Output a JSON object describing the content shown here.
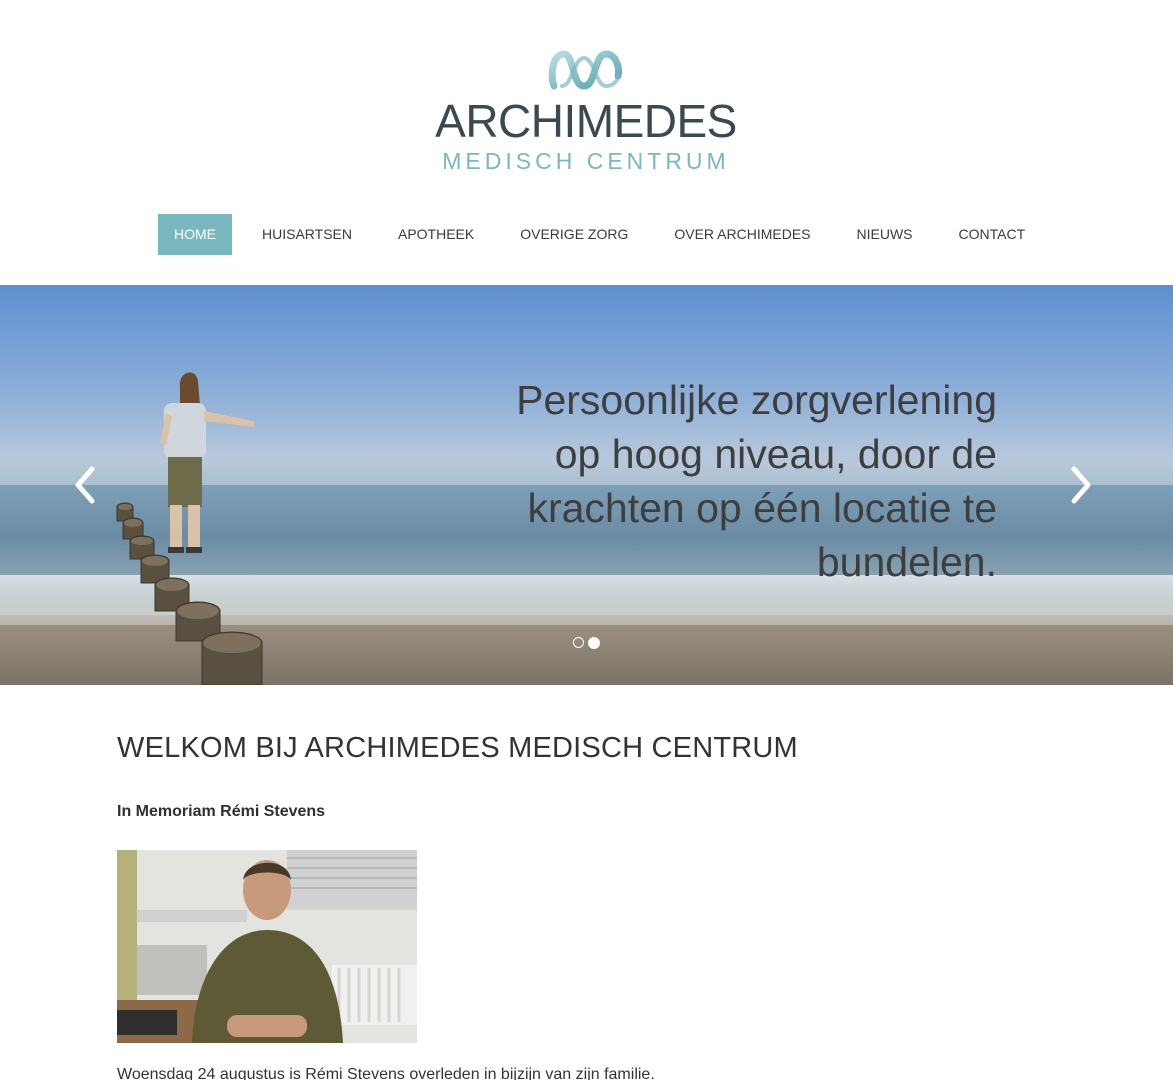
{
  "logo": {
    "name": "ARCHIMEDES",
    "subtitle": "MEDISCH CENTRUM",
    "mark_icon": "archimedes-wave-logo-icon"
  },
  "nav": {
    "items": [
      {
        "label": "HOME",
        "active": true
      },
      {
        "label": "HUISARTSEN",
        "active": false
      },
      {
        "label": "APOTHEEK",
        "active": false
      },
      {
        "label": "OVERIGE ZORG",
        "active": false
      },
      {
        "label": "OVER ARCHIMEDES",
        "active": false
      },
      {
        "label": "NIEUWS",
        "active": false
      },
      {
        "label": "CONTACT",
        "active": false
      }
    ]
  },
  "hero": {
    "caption": "Persoonlijke zorgverlening op hoog niveau, door de krachten op één locatie te bundelen.",
    "prev_icon": "chevron-left-icon",
    "next_icon": "chevron-right-icon",
    "slides_count": 2,
    "active_slide": 2
  },
  "content": {
    "heading": "WELKOM BIJ ARCHIMEDES MEDISCH CENTRUM",
    "memoriam_title": "In Memoriam Rémi Stevens",
    "body_first_line": "Woensdag 24 augustus is Rémi Stevens overleden in bijzijn van zijn familie."
  },
  "colors": {
    "accent": "#7ab8bf",
    "logo_dark": "#3a4a52",
    "text": "#333333"
  }
}
